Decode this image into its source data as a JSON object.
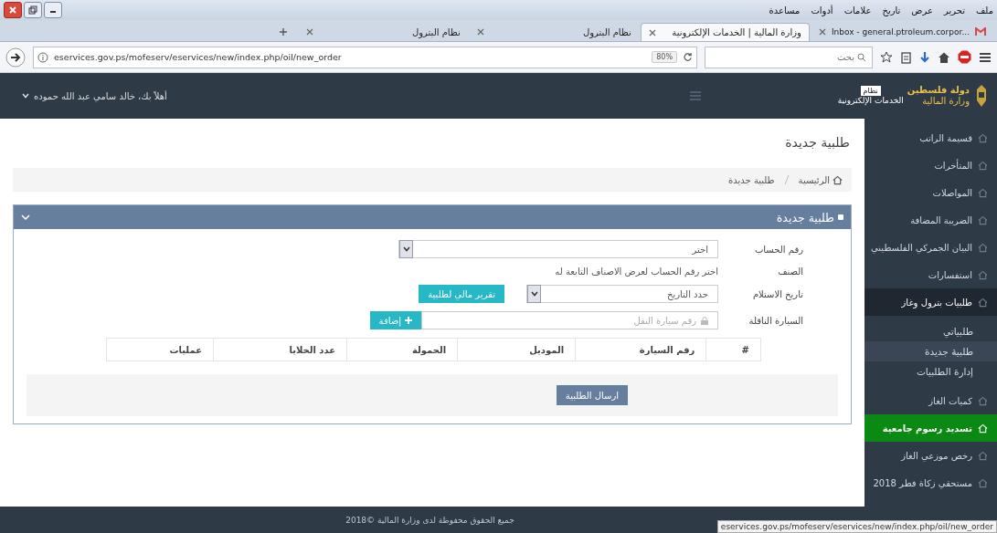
{
  "browser": {
    "menu": [
      "ملف",
      "تحرير",
      "عرض",
      "تاريخ",
      "علامات",
      "أدوات",
      "مساعدة"
    ],
    "tabs": [
      {
        "label": "Inbox - general.ptroleum.corpor...",
        "kind": "mail",
        "selected": false
      },
      {
        "label": "وزارة المالية | الخدمات الإلكترونية",
        "kind": "page",
        "selected": true
      },
      {
        "label": "نظام البترول",
        "kind": "page",
        "selected": false
      },
      {
        "label": "نظام البترول",
        "kind": "page",
        "selected": false
      }
    ],
    "url": "eservices.gov.ps/mofeserv/eservices/new/index.php/oil/new_order",
    "zoom": "80%",
    "search_placeholder": "بحث"
  },
  "header": {
    "logo": {
      "line1": "دولة فلسطين",
      "line2": "وزارة المالية",
      "badge": "نظام",
      "subtitle": "الخدمات الإلكترونية"
    },
    "user": "أهلاً بك، خالد سامي عبد الله حموده"
  },
  "sidebar": {
    "items": [
      {
        "label": "قسيمة الراتب",
        "selected": false
      },
      {
        "label": "المتأخرات",
        "selected": false
      },
      {
        "label": "المواصلات",
        "selected": false
      },
      {
        "label": "الضريبة المضافة",
        "selected": false
      },
      {
        "label": "البيان الجمركي الفلسطيني",
        "selected": false
      },
      {
        "label": "استفسارات",
        "selected": false
      },
      {
        "label": "طلبيات بترول وغاز",
        "selected": false,
        "expanded": true,
        "children": [
          {
            "label": "طلبياتي",
            "selected": false
          },
          {
            "label": "طلبية جديدة",
            "selected": true
          },
          {
            "label": "إدارة الطلبيات",
            "selected": false
          }
        ]
      },
      {
        "label": "كميات الغاز",
        "selected": false
      },
      {
        "label": "تسديد رسوم جامعية",
        "selected": true
      },
      {
        "label": "رخص موزعي الغاز",
        "selected": false
      },
      {
        "label": "مستحقي زكاة فطر 2018",
        "selected": false
      }
    ]
  },
  "page_title": "طلبية جديدة",
  "breadcrumb": [
    "الرئيسية",
    "طلبية جديدة"
  ],
  "panel": {
    "title": "طلبية جديدة",
    "rows": [
      {
        "kind": "select",
        "label": "رقم الحساب",
        "value": "اختر"
      },
      {
        "kind": "text",
        "label": "الصنف",
        "text": "اختر رقم الحساب لعرض الاصناف التابعة له"
      },
      {
        "kind": "select",
        "label": "تاريخ الاستلام",
        "value": "حدد التاريخ",
        "button": "تقرير مالي لطلبية"
      },
      {
        "kind": "input",
        "label": "السيارة الناقلة",
        "placeholder": "رقم سيارة النقل",
        "button": "إضافة"
      }
    ],
    "table": {
      "columns": [
        "#",
        "رقم السيارة",
        "الموديل",
        "الحمولة",
        "عدد الخلايا",
        "عمليات"
      ]
    },
    "submit": "ارسال الطلبية"
  },
  "footer": "جميع الحقوق محفوظة لدى وزارة المالية ©2018",
  "status_url": "eservices.gov.ps/mofeserv/eservices/new/index.php/oil/new_order"
}
